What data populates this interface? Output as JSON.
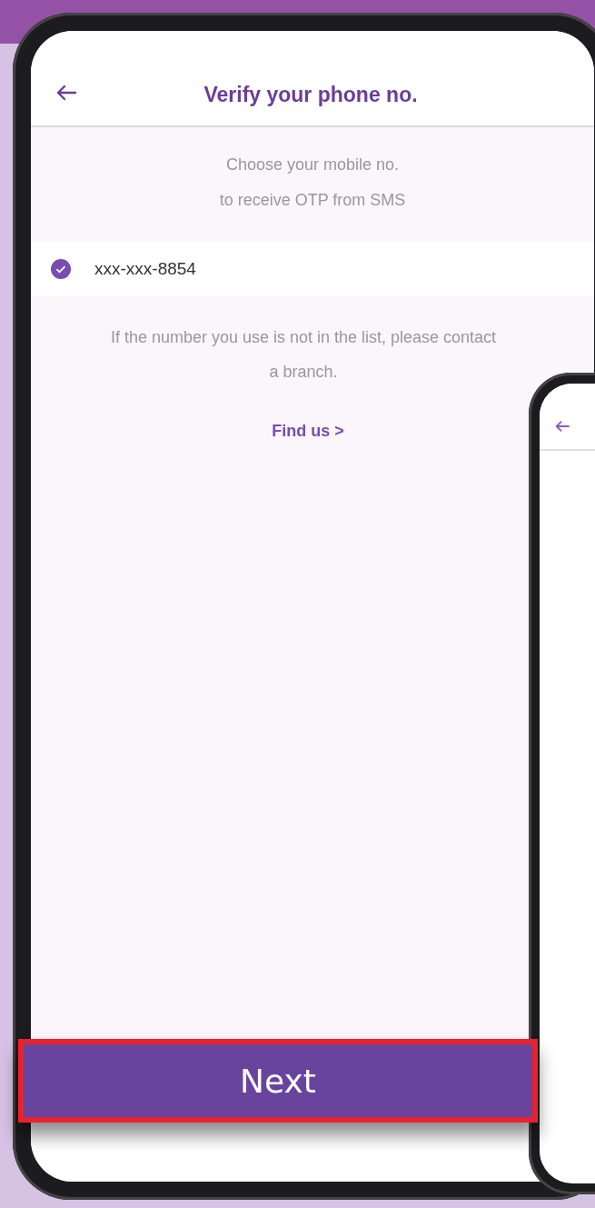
{
  "header": {
    "title": "Verify your phone no."
  },
  "instruction": "Choose your mobile no.\nto receive OTP from SMS",
  "phone_options": [
    {
      "number": "xxx-xxx-8854",
      "selected": true
    }
  ],
  "note": "If the number you use is not in the list, please contact\na branch.",
  "link": "Find us >",
  "button": "Next"
}
